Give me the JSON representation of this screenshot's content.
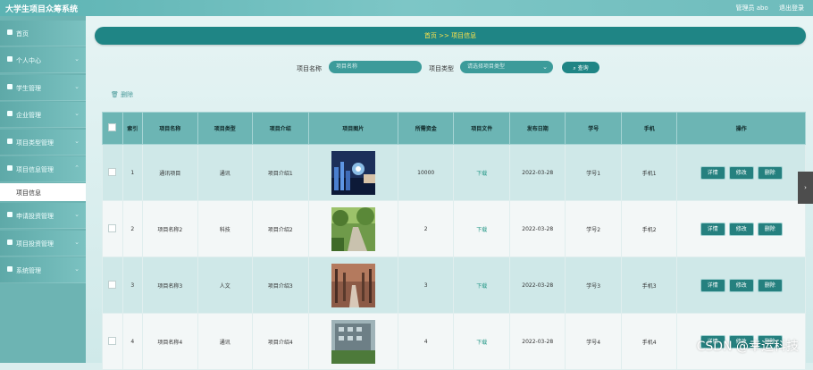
{
  "app": {
    "title": "大学生项目众筹系统"
  },
  "topbar": {
    "user_label": "管理员 abo",
    "logout": "退出登录"
  },
  "sidebar": {
    "items": [
      {
        "label": "首页",
        "icon": "home-icon"
      },
      {
        "label": "个人中心",
        "icon": "user-icon"
      },
      {
        "label": "学生管理",
        "icon": "grid-icon"
      },
      {
        "label": "企业管理",
        "icon": "apps-icon"
      },
      {
        "label": "项目类型管理",
        "icon": "grid-icon"
      },
      {
        "label": "项目信息管理",
        "icon": "chart-icon"
      },
      {
        "label": "申请投资管理",
        "icon": "list-icon"
      },
      {
        "label": "项目投资管理",
        "icon": "apps-icon"
      },
      {
        "label": "系统管理",
        "icon": "apps-icon"
      }
    ],
    "sub_active": "项目信息"
  },
  "breadcrumb": {
    "home": "首页",
    "sep": ">>",
    "current": "项目信息"
  },
  "search": {
    "name_label": "项目名称",
    "name_placeholder": "项目名称",
    "type_label": "项目类型",
    "type_placeholder": "请选择项目类型",
    "query_button": "查询"
  },
  "actions": {
    "delete_label": "删除"
  },
  "table": {
    "headers": [
      "",
      "索引",
      "项目名称",
      "项目类型",
      "项目介绍",
      "项目图片",
      "所需资金",
      "项目文件",
      "发布日期",
      "学号",
      "手机",
      "操作"
    ],
    "rows": [
      {
        "index": "1",
        "name": "通讯项目",
        "type": "通讯",
        "intro": "项目介绍1",
        "funds": "10000",
        "file": "下载",
        "date": "2022-03-28",
        "student_no": "学号1",
        "phone": "手机1"
      },
      {
        "index": "2",
        "name": "项目名称2",
        "type": "科技",
        "intro": "项目介绍2",
        "funds": "2",
        "file": "下载",
        "date": "2022-03-28",
        "student_no": "学号2",
        "phone": "手机2"
      },
      {
        "index": "3",
        "name": "项目名称3",
        "type": "人文",
        "intro": "项目介绍3",
        "funds": "3",
        "file": "下载",
        "date": "2022-03-28",
        "student_no": "学号3",
        "phone": "手机3"
      },
      {
        "index": "4",
        "name": "项目名称4",
        "type": "通讯",
        "intro": "项目介绍4",
        "funds": "4",
        "file": "下载",
        "date": "2022-03-28",
        "student_no": "学号4",
        "phone": "手机4"
      }
    ],
    "row_buttons": {
      "detail": "详情",
      "edit": "修改",
      "delete": "删除"
    }
  },
  "watermark": "CSDN @幸运科技",
  "colors": {
    "primary": "#1f8585",
    "header": "#6cb5b4",
    "accent": "#ffe24a"
  }
}
